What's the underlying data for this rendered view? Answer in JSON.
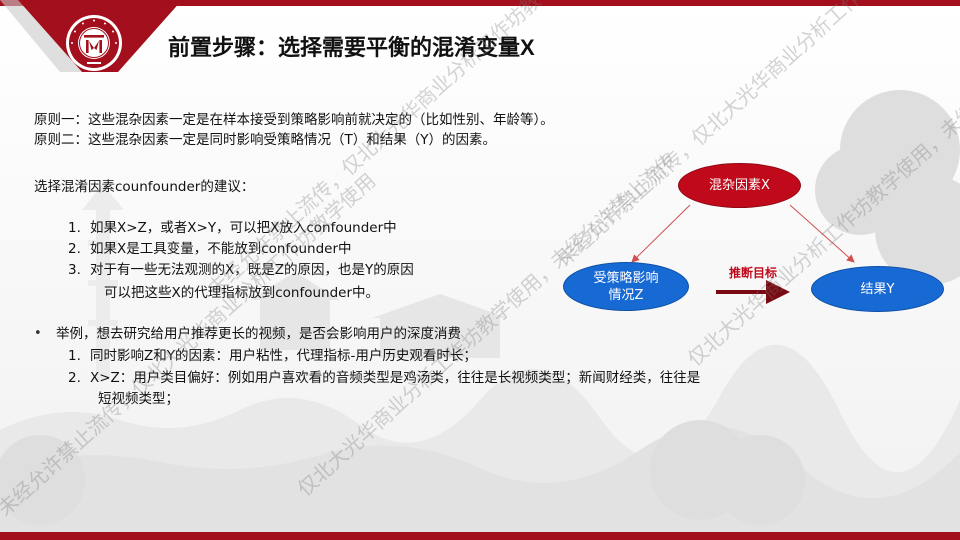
{
  "title": {
    "main": "前置步骤：选择需要平衡的混淆变量",
    "x": "X"
  },
  "principles": [
    "原则一：这些混杂因素一定是在样本接受到策略影响前就决定的（比如性别、年龄等）。",
    "原则二：这些混杂因素一定是同时影响受策略情况（T）和结果（Y）的因素。"
  ],
  "suggestion_heading": "选择混淆因素counfounder的建议：",
  "suggestions": [
    {
      "num": "1.",
      "text": "如果X>Z，或者X>Y，可以把X放入confounder中"
    },
    {
      "num": "2.",
      "text": "如果X是工具变量，不能放到confounder中"
    },
    {
      "num": "3.",
      "text": "对于有一些无法观测的X，既是Z的原因，也是Y的原因"
    }
  ],
  "suggestion_cont": "可以把这些X的代理指标放到confounder中。",
  "example": {
    "bullet": "•",
    "heading": "举例，想去研究给用户推荐更长的视频，是否会影响用户的深度消费",
    "items": [
      {
        "num": "1.",
        "text": "同时影响Z和Y的因素：用户粘性，代理指标-用户历史观看时长；"
      },
      {
        "num": "2.",
        "text": "X>Z：用户类目偏好：例如用户喜欢看的音频类型是鸡汤类，往往是长视频类型；新闻财经类，往往是"
      }
    ],
    "cont": "短视频类型；"
  },
  "diagram": {
    "confounder": "混杂因素X",
    "treatment_line1": "受策略影响",
    "treatment_line2": "情况Z",
    "outcome": "结果Y",
    "arrow_label": "推断目标"
  },
  "watermarks": [
    "未经允许禁止流传，仅北大光华商业分析工作坊教学使用",
    "仅北大光华商业分析工作坊教学使用，未经允许禁止流传"
  ],
  "colors": {
    "brand_red": "#a30f1c",
    "node_blue": "#1769d4",
    "node_red": "#c00a1c"
  }
}
